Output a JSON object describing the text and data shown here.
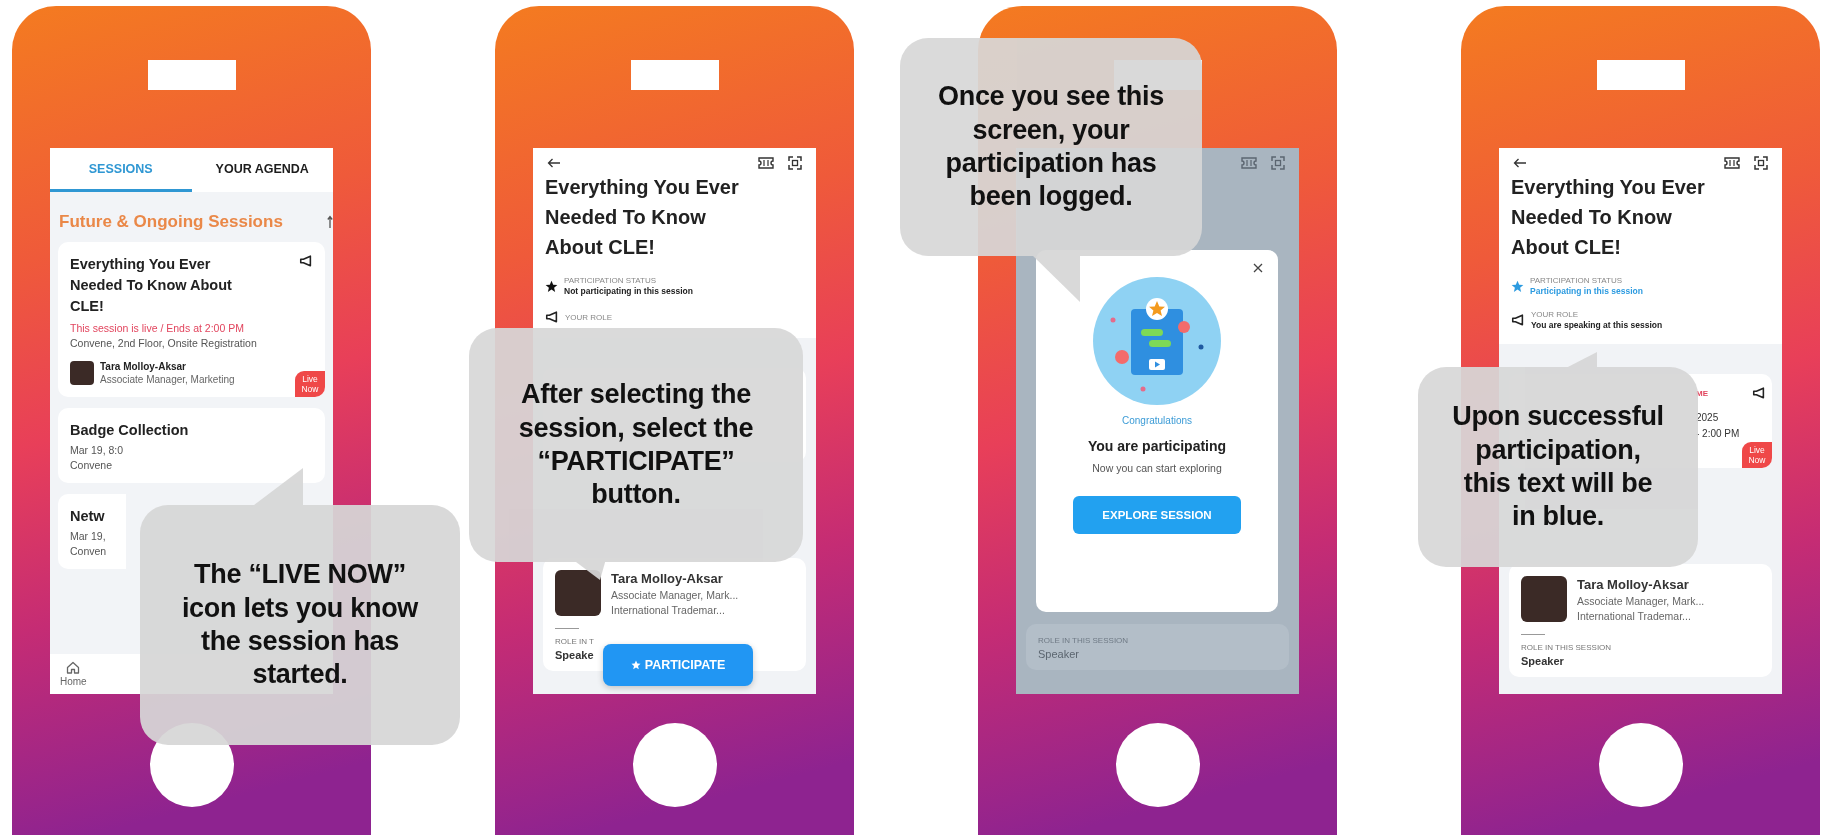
{
  "phones": [
    {
      "kind": "session_list",
      "tabs": [
        {
          "label": "SESSIONS",
          "selected": true
        },
        {
          "label": "YOUR AGENDA",
          "selected": false
        }
      ],
      "section_title": "Future & Ongoing Sessions",
      "sessions": [
        {
          "title": "Everything You Ever Needed To Know About CLE!",
          "live_text": "This session is live / Ends at 2:00 PM",
          "location": "Convene, 2nd Floor, Onsite Registration",
          "speaker_name": "Tara Molloy-Aksar",
          "speaker_role": "Associate Manager, Marketing",
          "badge": "Live Now"
        },
        {
          "title": "Badge Collection",
          "time": "Mar 19, 8:0",
          "location": "Convene"
        },
        {
          "title": "Netw",
          "time": "Mar 19,",
          "location": "Conven"
        }
      ],
      "nav": [
        "Home"
      ],
      "callout": [
        "The  “LIVE NOW”",
        "icon lets you know",
        "the session has",
        "started."
      ]
    },
    {
      "kind": "session_detail",
      "title": "Everything You Ever Needed To Know About CLE!",
      "status_label": "PARTICIPATION STATUS",
      "status_value": "Not participating in this session",
      "participating": false,
      "role_label": "YOUR ROLE",
      "speaker": {
        "name": "Tara Molloy-Aksar",
        "lines": [
          "Associate Manager, Mark...",
          "International Trademar..."
        ],
        "role_label": "ROLE IN T",
        "role_value": "Speake"
      },
      "action": "PARTICIPATE",
      "callout": [
        "After selecting the",
        "session, select the",
        "“PARTICIPATE”",
        "button."
      ]
    },
    {
      "kind": "confirmation",
      "speaker": {
        "role_label": "ROLE IN THIS SESSION",
        "role_value": "Speaker"
      },
      "modal": {
        "eyebrow": "Congratulations",
        "title": "You are participating",
        "subtitle": "Now you can start exploring",
        "button": "EXPLORE SESSION"
      },
      "callout": [
        "Once you see this",
        "screen, your",
        "participation has",
        "been logged."
      ]
    },
    {
      "kind": "session_detail",
      "title": "Everything You Ever Needed To Know About CLE!",
      "status_label": "PARTICIPATION STATUS",
      "status_value": "Participating in this session",
      "participating": true,
      "role_label": "YOUR ROLE",
      "role_value": "You are speaking at this session",
      "details": {
        "label": "ME",
        "date": "2025",
        "time": "- 2:00 PM",
        "badge": "Live Now"
      },
      "speaker": {
        "name": "Tara Molloy-Aksar",
        "lines": [
          "Associate Manager, Mark...",
          "International Trademar..."
        ],
        "role_label": "ROLE IN THIS SESSION",
        "role_value": "Speaker"
      },
      "callout": [
        "Upon successful",
        "participation,",
        "this text will be",
        "in blue."
      ]
    }
  ]
}
